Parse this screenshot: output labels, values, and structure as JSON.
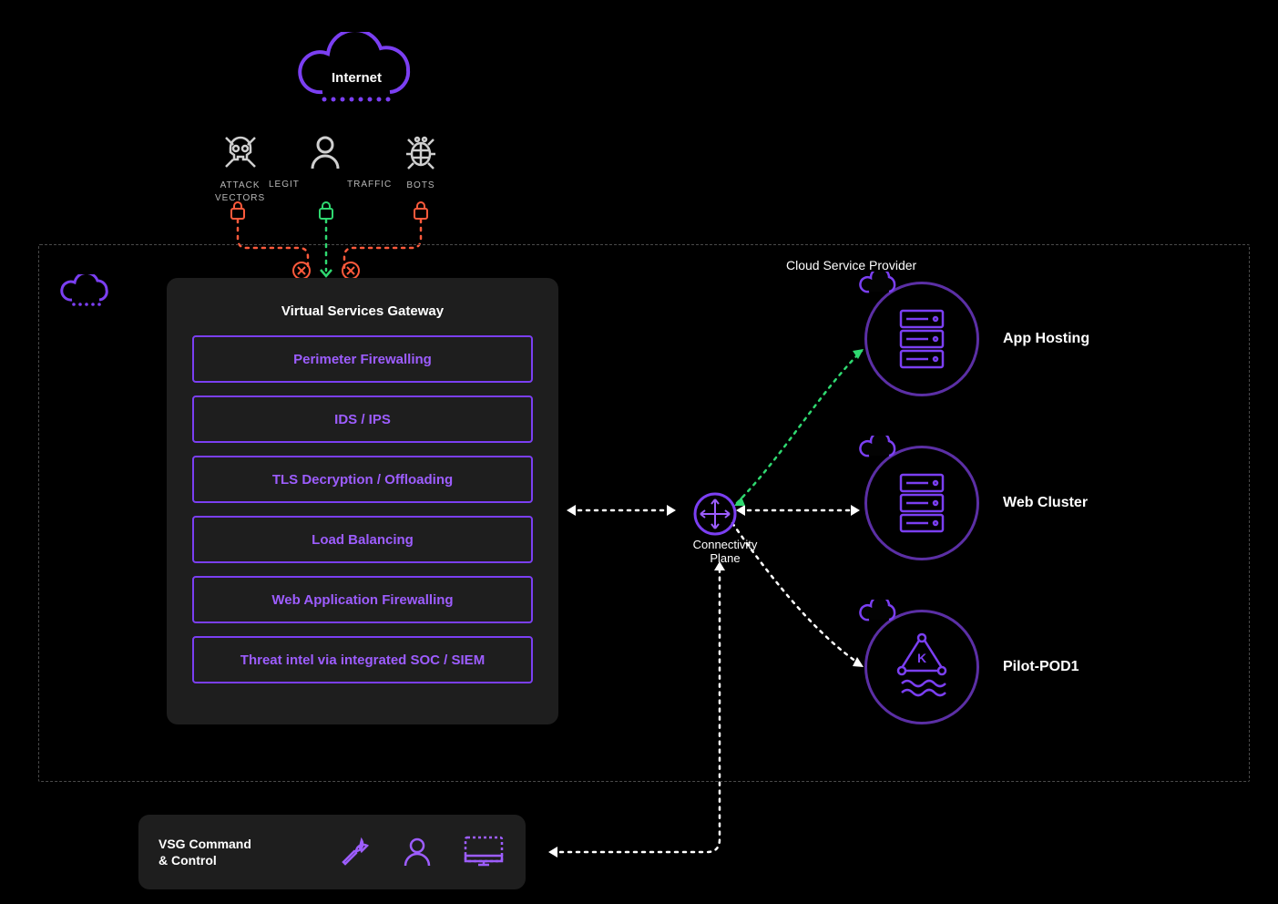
{
  "internet": {
    "label": "Internet"
  },
  "threats": {
    "attack": {
      "label": "ATTACK\nVECTORS",
      "icon": "skull-icon",
      "lock_color": "#ff5a3c"
    },
    "legit": {
      "left_label": "LEGIT",
      "right_label": "TRAFFIC",
      "icon": "person-icon",
      "lock_color": "#2fd870"
    },
    "bots": {
      "label": "BOTS",
      "icon": "bug-icon",
      "lock_color": "#ff5a3c"
    }
  },
  "provider": {
    "title": "Cloud Service Provider"
  },
  "vsg": {
    "title": "Virtual Services Gateway",
    "services": [
      "Perimeter Firewalling",
      "IDS / IPS",
      "TLS Decryption / Offloading",
      "Load Balancing",
      "Web Application Firewalling",
      "Threat intel via integrated SOC / SIEM"
    ]
  },
  "connectivity": {
    "label": "Connectivity\nPlane"
  },
  "environments": [
    {
      "label": "App Hosting",
      "icon": "server-icon"
    },
    {
      "label": "Web Cluster",
      "icon": "server-icon"
    },
    {
      "label": "Pilot-POD1",
      "icon": "k8s-icon"
    }
  ],
  "command": {
    "label": "VSG Command\n& Control"
  },
  "colors": {
    "purple": "#7b3ff2",
    "purple_light": "#9d5dff",
    "green": "#2fd870",
    "orange": "#ff5a3c",
    "grey": "#cfcfcf"
  }
}
